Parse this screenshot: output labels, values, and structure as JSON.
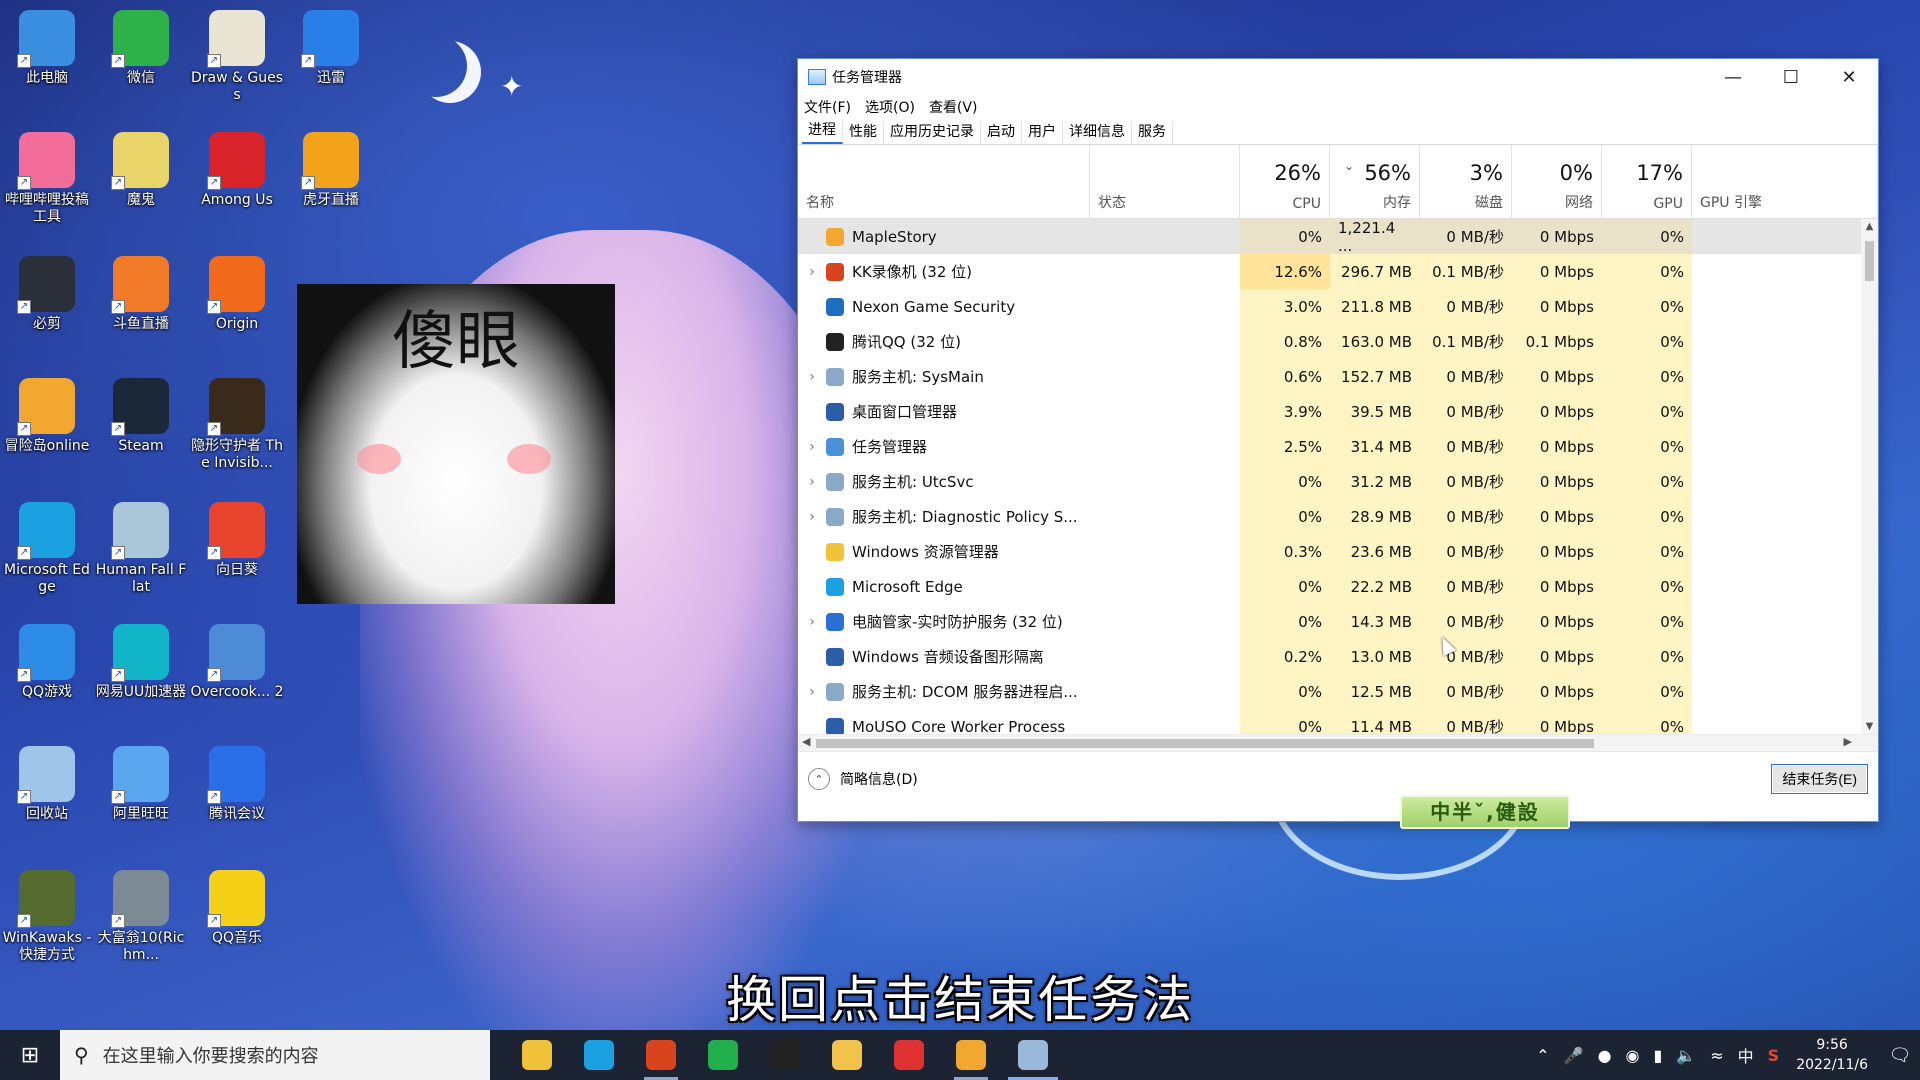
{
  "desktop": {
    "icons": [
      {
        "label": "此电脑",
        "color": "#3b8fe0"
      },
      {
        "label": "微信",
        "color": "#2fb14a"
      },
      {
        "label": "Draw & Guess",
        "color": "#e9e4d4"
      },
      {
        "label": "迅雷",
        "color": "#2a7ee8"
      },
      {
        "label": "哔哩哔哩投稿工具",
        "color": "#f36d9a"
      },
      {
        "label": "魔鬼",
        "color": "#e9d46a"
      },
      {
        "label": "Among Us",
        "color": "#d8232a"
      },
      {
        "label": "虎牙直播",
        "color": "#f2a31a"
      },
      {
        "label": "必剪",
        "color": "#2b2f3a"
      },
      {
        "label": "斗鱼直播",
        "color": "#f07a28"
      },
      {
        "label": "Origin",
        "color": "#f26a1b"
      },
      {
        "label": "冒险岛online",
        "color": "#f2a830"
      },
      {
        "label": "Steam",
        "color": "#1b2838"
      },
      {
        "label": "隐形守护者 The Invisib...",
        "color": "#3a2a1a"
      },
      {
        "label": "Microsoft Edge",
        "color": "#1ba1e2"
      },
      {
        "label": "Human Fall Flat",
        "color": "#a9c7d8"
      },
      {
        "label": "向日葵",
        "color": "#e8432d"
      },
      {
        "label": "QQ游戏",
        "color": "#2d8ce8"
      },
      {
        "label": "网易UU加速器",
        "color": "#12b5c7"
      },
      {
        "label": "Overcook... 2",
        "color": "#4d8bd6"
      },
      {
        "label": "回收站",
        "color": "#9fc6e8"
      },
      {
        "label": "阿里旺旺",
        "color": "#5aa7f0"
      },
      {
        "label": "腾讯会议",
        "color": "#2b6fe8"
      },
      {
        "label": "WinKawaks - 快捷方式",
        "color": "#556b2f"
      },
      {
        "label": "大富翁10(Richm...",
        "color": "#7c8a96"
      },
      {
        "label": "QQ音乐",
        "color": "#f5d016"
      }
    ]
  },
  "meme": {
    "text": "傻眼"
  },
  "task_manager": {
    "title": "任务管理器",
    "menu": [
      "文件(F)",
      "选项(O)",
      "查看(V)"
    ],
    "tabs": [
      "进程",
      "性能",
      "应用历史记录",
      "启动",
      "用户",
      "详细信息",
      "服务"
    ],
    "columns": {
      "name": "名称",
      "status": "状态",
      "cpu": {
        "pct": "26%",
        "label": "CPU"
      },
      "memory": {
        "pct": "56%",
        "label": "内存"
      },
      "disk": {
        "pct": "3%",
        "label": "磁盘"
      },
      "network": {
        "pct": "0%",
        "label": "网络"
      },
      "gpu": {
        "pct": "17%",
        "label": "GPU"
      },
      "gpu_engine": "GPU 引擎"
    },
    "processes": [
      {
        "name": "MapleStory",
        "expandable": false,
        "icon_color": "#f2a830",
        "cpu": "0%",
        "memory": "1,221.4 ...",
        "disk": "0 MB/秒",
        "network": "0 Mbps",
        "gpu": "0%",
        "selected": true
      },
      {
        "name": "KK录像机 (32 位)",
        "expandable": true,
        "icon_color": "#d9431e",
        "cpu": "12.6%",
        "memory": "296.7 MB",
        "disk": "0.1 MB/秒",
        "network": "0 Mbps",
        "gpu": "0%"
      },
      {
        "name": "Nexon Game Security",
        "expandable": false,
        "icon_color": "#1f6fc0",
        "cpu": "3.0%",
        "memory": "211.8 MB",
        "disk": "0 MB/秒",
        "network": "0 Mbps",
        "gpu": "0%"
      },
      {
        "name": "腾讯QQ (32 位)",
        "expandable": false,
        "icon_color": "#222222",
        "cpu": "0.8%",
        "memory": "163.0 MB",
        "disk": "0.1 MB/秒",
        "network": "0.1 Mbps",
        "gpu": "0%"
      },
      {
        "name": "服务主机: SysMain",
        "expandable": true,
        "icon_color": "#8aa9c8",
        "cpu": "0.6%",
        "memory": "152.7 MB",
        "disk": "0 MB/秒",
        "network": "0 Mbps",
        "gpu": "0%"
      },
      {
        "name": "桌面窗口管理器",
        "expandable": false,
        "icon_color": "#2c5ea8",
        "cpu": "3.9%",
        "memory": "39.5 MB",
        "disk": "0 MB/秒",
        "network": "0 Mbps",
        "gpu": "0%"
      },
      {
        "name": "任务管理器",
        "expandable": true,
        "icon_color": "#4a90d9",
        "cpu": "2.5%",
        "memory": "31.4 MB",
        "disk": "0 MB/秒",
        "network": "0 Mbps",
        "gpu": "0%"
      },
      {
        "name": "服务主机: UtcSvc",
        "expandable": true,
        "icon_color": "#8aa9c8",
        "cpu": "0%",
        "memory": "31.2 MB",
        "disk": "0 MB/秒",
        "network": "0 Mbps",
        "gpu": "0%"
      },
      {
        "name": "服务主机: Diagnostic Policy S...",
        "expandable": true,
        "icon_color": "#8aa9c8",
        "cpu": "0%",
        "memory": "28.9 MB",
        "disk": "0 MB/秒",
        "network": "0 Mbps",
        "gpu": "0%"
      },
      {
        "name": "Windows 资源管理器",
        "expandable": false,
        "icon_color": "#f0c23a",
        "cpu": "0.3%",
        "memory": "23.6 MB",
        "disk": "0 MB/秒",
        "network": "0 Mbps",
        "gpu": "0%"
      },
      {
        "name": "Microsoft Edge",
        "expandable": false,
        "icon_color": "#1ba1e2",
        "cpu": "0%",
        "memory": "22.2 MB",
        "disk": "0 MB/秒",
        "network": "0 Mbps",
        "gpu": "0%"
      },
      {
        "name": "电脑管家-实时防护服务 (32 位)",
        "expandable": true,
        "icon_color": "#2a6fd6",
        "cpu": "0%",
        "memory": "14.3 MB",
        "disk": "0 MB/秒",
        "network": "0 Mbps",
        "gpu": "0%"
      },
      {
        "name": "Windows 音频设备图形隔离",
        "expandable": false,
        "icon_color": "#2c5ea8",
        "cpu": "0.2%",
        "memory": "13.0 MB",
        "disk": "0 MB/秒",
        "network": "0 Mbps",
        "gpu": "0%"
      },
      {
        "name": "服务主机: DCOM 服务器进程启...",
        "expandable": true,
        "icon_color": "#8aa9c8",
        "cpu": "0%",
        "memory": "12.5 MB",
        "disk": "0 MB/秒",
        "network": "0 Mbps",
        "gpu": "0%"
      },
      {
        "name": "MoUSO Core Worker Process",
        "expandable": false,
        "icon_color": "#2c5ea8",
        "cpu": "0%",
        "memory": "11.4 MB",
        "disk": "0 MB/秒",
        "network": "0 Mbps",
        "gpu": "0%"
      }
    ],
    "footer": {
      "fewer_details": "简略信息(D)",
      "end_task": "结束任务(E)"
    }
  },
  "stamp": {
    "text": "中半ˇ,健設"
  },
  "caption": "换回点击结束任务法",
  "taskbar": {
    "search_placeholder": "在这里输入你要搜索的内容",
    "apps": [
      {
        "name": "file-explorer",
        "color": "#f0c23a"
      },
      {
        "name": "edge",
        "color": "#1ba1e2"
      },
      {
        "name": "kk-recorder",
        "color": "#d9431e"
      },
      {
        "name": "iqiyi",
        "color": "#21b04c"
      },
      {
        "name": "qq",
        "color": "#222222"
      },
      {
        "name": "maplestory-launcher",
        "color": "#f2c24a"
      },
      {
        "name": "netease-music",
        "color": "#e03131"
      },
      {
        "name": "maplestory",
        "color": "#f2a830"
      },
      {
        "name": "task-manager",
        "color": "#9ab8da"
      }
    ],
    "ime": "中",
    "time": "9:56",
    "date": "2022/11/6"
  }
}
